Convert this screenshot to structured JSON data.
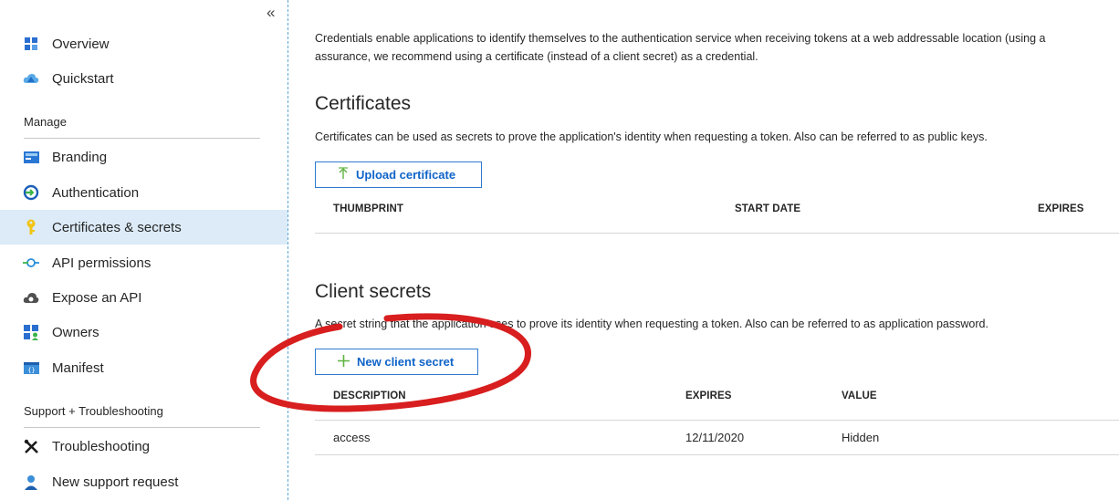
{
  "sidebar": {
    "collapse_glyph": "«",
    "items_top": [
      {
        "label": "Overview",
        "icon": "overview-grid-icon"
      },
      {
        "label": "Quickstart",
        "icon": "quickstart-cloud-icon"
      }
    ],
    "manage_heading": "Manage",
    "manage_items": [
      {
        "label": "Branding",
        "icon": "branding-card-icon"
      },
      {
        "label": "Authentication",
        "icon": "authentication-icon"
      },
      {
        "label": "Certificates & secrets",
        "icon": "key-icon",
        "active": true
      },
      {
        "label": "API permissions",
        "icon": "api-permissions-icon"
      },
      {
        "label": "Expose an API",
        "icon": "cloud-gear-icon"
      },
      {
        "label": "Owners",
        "icon": "owners-grid-icon"
      },
      {
        "label": "Manifest",
        "icon": "manifest-icon"
      }
    ],
    "support_heading": "Support + Troubleshooting",
    "support_items": [
      {
        "label": "Troubleshooting",
        "icon": "tools-icon"
      },
      {
        "label": "New support request",
        "icon": "support-person-icon"
      }
    ]
  },
  "main": {
    "intro_line1": "Credentials enable applications to identify themselves to the authentication service when receiving tokens at a web addressable location (using a",
    "intro_line2": "assurance, we recommend using a certificate (instead of a client secret) as a credential.",
    "certificates": {
      "heading": "Certificates",
      "description": "Certificates can be used as secrets to prove the application's identity when requesting a token. Also can be referred to as public keys.",
      "upload_button": "Upload certificate",
      "columns": [
        "THUMBPRINT",
        "START DATE",
        "EXPIRES"
      ]
    },
    "client_secrets": {
      "heading": "Client secrets",
      "description": "A secret string that the application uses to prove its identity when requesting a token. Also can be referred to as application password.",
      "new_button": "New client secret",
      "columns": [
        "DESCRIPTION",
        "EXPIRES",
        "VALUE"
      ],
      "rows": [
        {
          "description": "access",
          "expires": "12/11/2020",
          "value": "Hidden"
        }
      ]
    }
  },
  "colors": {
    "accent": "#0f64c8",
    "active_bg": "#dcebf7",
    "annotation": "#d81e1e"
  }
}
